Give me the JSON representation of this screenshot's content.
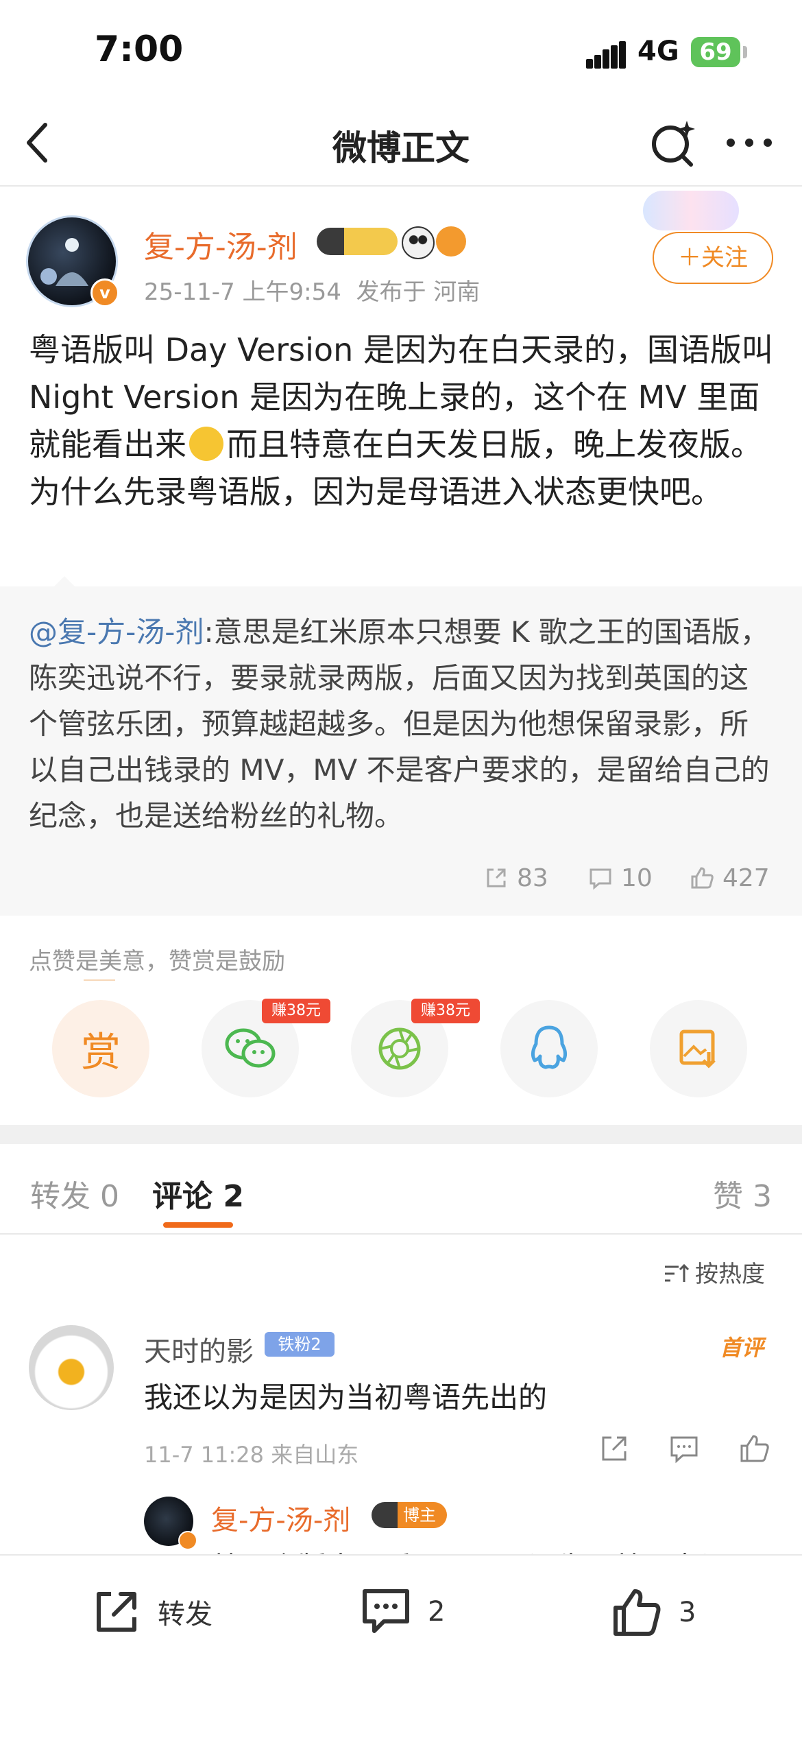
{
  "status_bar": {
    "time": "7:00",
    "network": "4G",
    "battery": "69"
  },
  "nav": {
    "title": "微博正文",
    "back_icon": "chevron-left-icon",
    "search_icon": "sparkle-search-icon",
    "more_icon": "more-dots-icon"
  },
  "post": {
    "author": "复-方-汤-剂",
    "timestamp": "25-11-7 上午9:54",
    "location": "发布于 河南",
    "follow_label": "＋关注",
    "body_part1": "粤语版叫 Day Version 是因为在白天录的，国语版叫 Night Version 是因为在晚上录的，这个在 MV 里面就能看出来",
    "body_part2": "而且特意在白天发日版，晚上发夜版。为什么先录粤语版，因为是母语进入状态更快吧。"
  },
  "quote": {
    "mention": "@复-方-汤-剂",
    "text": ":意思是红米原本只想要 K 歌之王的国语版，陈奕迅说不行，要录就录两版，后面又因为找到英国的这个管弦乐团，预算越超越多。但是因为他想保留录影，所以自己出钱录的 MV，MV 不是客户要求的，是留给自己的纪念，也是送给粉丝的礼物。",
    "reposts": "83",
    "comments": "10",
    "likes": "427"
  },
  "reward": {
    "hint": "点赞是美意，赞赏是鼓励",
    "reward_label": "赏",
    "earn_tag_1": "赚38元",
    "earn_tag_2": "赚38元"
  },
  "tabs": {
    "repost": "转发 0",
    "comment": "评论 2",
    "like": "赞 3",
    "sort_label": "按热度"
  },
  "comments": [
    {
      "name": "天时的影",
      "badge": "铁粉2",
      "first_badge": "首评",
      "text": "我还以为是因为当初粤语先出的",
      "meta": "11-7 11:28  来自山东",
      "reply": {
        "name": "复-方-汤-剂",
        "badge": "博主",
        "text": "就开个版本，后面不是国语先录就是粤语"
      }
    }
  ],
  "bottom_bar": {
    "repost_label": "转发",
    "comment_count": "2",
    "like_count": "3"
  },
  "colors": {
    "accent": "#f08a24",
    "author": "#e86b2b",
    "link": "#4a78b0",
    "earn_tag": "#ef4a34"
  }
}
